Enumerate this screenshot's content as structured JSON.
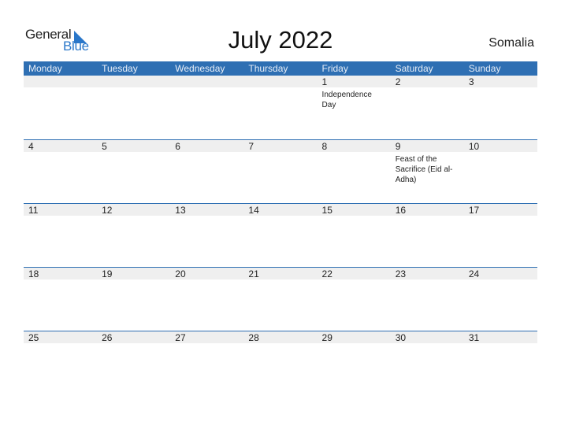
{
  "logo": {
    "text_general": "General",
    "text_blue": "Blue"
  },
  "title": "July 2022",
  "country": "Somalia",
  "colors": {
    "accent": "#2e6fb3",
    "strip": "#efefef"
  },
  "weekdays": [
    "Monday",
    "Tuesday",
    "Wednesday",
    "Thursday",
    "Friday",
    "Saturday",
    "Sunday"
  ],
  "weeks": [
    [
      {
        "d": ""
      },
      {
        "d": ""
      },
      {
        "d": ""
      },
      {
        "d": ""
      },
      {
        "d": "1",
        "event": "Independence Day"
      },
      {
        "d": "2"
      },
      {
        "d": "3"
      }
    ],
    [
      {
        "d": "4"
      },
      {
        "d": "5"
      },
      {
        "d": "6"
      },
      {
        "d": "7"
      },
      {
        "d": "8"
      },
      {
        "d": "9",
        "event": "Feast of the Sacrifice (Eid al-Adha)"
      },
      {
        "d": "10"
      }
    ],
    [
      {
        "d": "11"
      },
      {
        "d": "12"
      },
      {
        "d": "13"
      },
      {
        "d": "14"
      },
      {
        "d": "15"
      },
      {
        "d": "16"
      },
      {
        "d": "17"
      }
    ],
    [
      {
        "d": "18"
      },
      {
        "d": "19"
      },
      {
        "d": "20"
      },
      {
        "d": "21"
      },
      {
        "d": "22"
      },
      {
        "d": "23"
      },
      {
        "d": "24"
      }
    ],
    [
      {
        "d": "25"
      },
      {
        "d": "26"
      },
      {
        "d": "27"
      },
      {
        "d": "28"
      },
      {
        "d": "29"
      },
      {
        "d": "30"
      },
      {
        "d": "31"
      }
    ]
  ]
}
